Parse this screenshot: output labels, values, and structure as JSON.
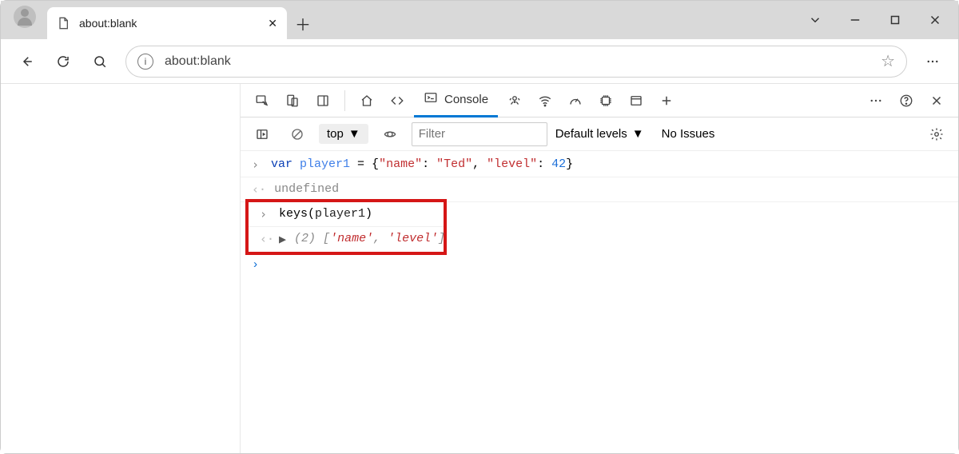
{
  "browser": {
    "tab_title": "about:blank",
    "address_url": "about:blank",
    "filter_placeholder": "Filter",
    "context_label": "top",
    "levels_label": "Default levels",
    "issues_label": "No Issues"
  },
  "devtools": {
    "active_tab": "Console"
  },
  "console": {
    "line1_keyword": "var",
    "line1_var": "player1",
    "line1_eq": " = {",
    "line1_key1": "\"name\"",
    "line1_colon1": ": ",
    "line1_val1": "\"Ted\"",
    "line1_comma": ", ",
    "line1_key2": "\"level\"",
    "line1_colon2": ": ",
    "line1_val2": "42",
    "line1_close": "}",
    "line2": "undefined",
    "line3_fn": "keys",
    "line3_open": "(",
    "line3_arg": "player1",
    "line3_close": ")",
    "line4_count": "(2)",
    "line4_open": " [",
    "line4_it1": "'name'",
    "line4_sep": ", ",
    "line4_it2": "'level'",
    "line4_close": "]"
  }
}
